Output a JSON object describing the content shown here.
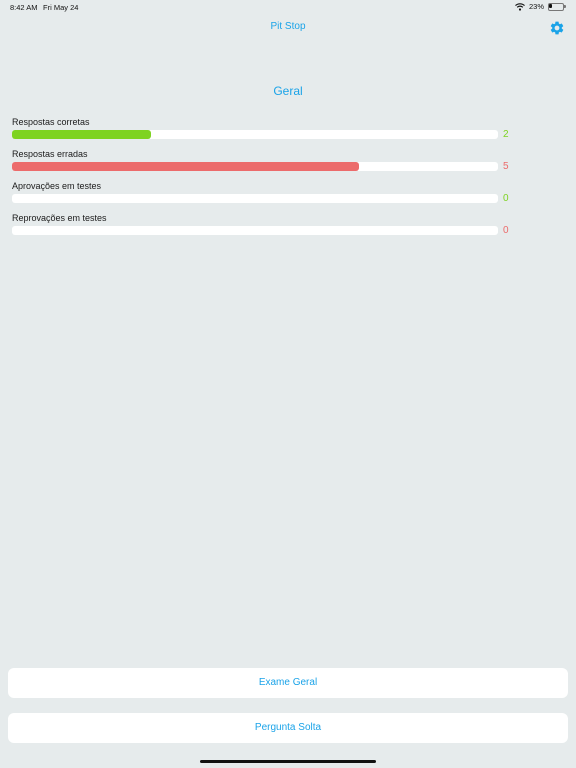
{
  "status_bar": {
    "time": "8:42 AM",
    "date": "Fri May 24",
    "battery_text": "23%",
    "battery_level": 0.23
  },
  "nav": {
    "title": "Pit Stop",
    "settings_icon": "gear-icon",
    "accent_color": "#1aa3e8"
  },
  "section": {
    "title": "Geral"
  },
  "stats": [
    {
      "label": "Respostas corretas",
      "value": "2",
      "fill_fraction": 0.285,
      "color": "#7ed321",
      "value_color": "#7ed321"
    },
    {
      "label": "Respostas erradas",
      "value": "5",
      "fill_fraction": 0.715,
      "color": "#ec6b6b",
      "value_color": "#ec6b6b"
    },
    {
      "label": "Aprovações em testes",
      "value": "0",
      "fill_fraction": 0,
      "color": "#7ed321",
      "value_color": "#7ed321"
    },
    {
      "label": "Reprovações em testes",
      "value": "0",
      "fill_fraction": 0,
      "color": "#ec6b6b",
      "value_color": "#ec6b6b"
    }
  ],
  "buttons": {
    "exam_label": "Exame Geral",
    "question_label": "Pergunta Solta"
  }
}
